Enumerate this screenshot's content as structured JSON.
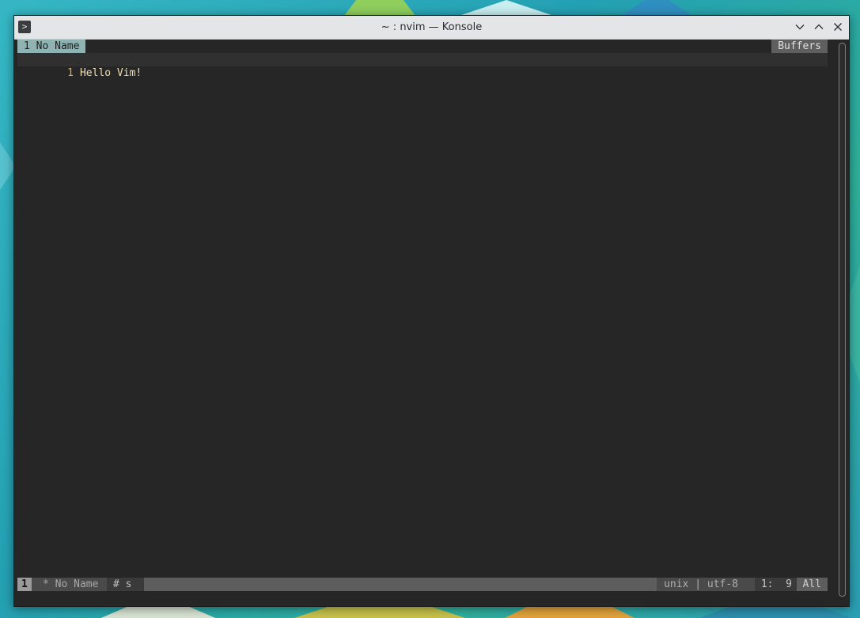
{
  "window": {
    "title": "~ : nvim — Konsole",
    "app_icon": ">"
  },
  "tabline": {
    "active_tab": "1 No Name",
    "buffers_label": "Buffers"
  },
  "buffer": {
    "lines": [
      {
        "number": "1",
        "text": "Hello Vim!"
      }
    ]
  },
  "statusline": {
    "buffer_number": "1",
    "file": "* No Name",
    "flags": "# s",
    "format": "unix | utf-8",
    "position": "1:  9",
    "percent": "All"
  },
  "colors": {
    "tab_active_bg": "#8fb2b2",
    "line_number": "#e5a94e",
    "text": "#f0dfb4",
    "editor_bg": "#262626"
  },
  "icons": {
    "app": "terminal-icon",
    "minimize": "chevron-down-icon",
    "maximize": "chevron-up-icon",
    "close": "close-icon"
  }
}
